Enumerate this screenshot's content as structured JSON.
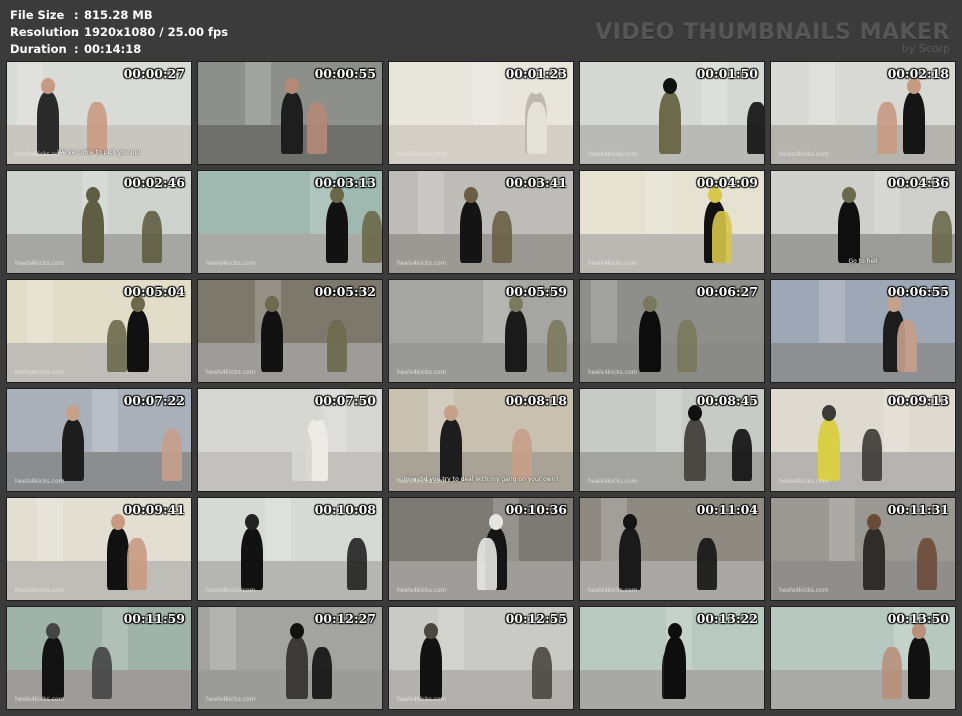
{
  "info": {
    "rows": [
      {
        "label": "File Size",
        "value": "815.28 MB"
      },
      {
        "label": "Resolution",
        "value": "1920x1080 / 25.00 fps"
      },
      {
        "label": "Duration",
        "value": "00:14:18"
      }
    ],
    "separator": ":"
  },
  "brand": {
    "title": "VIDEO THUMBNAILS MAKER",
    "subtitle": "by Scorp"
  },
  "thumbnails": [
    {
      "time": "00:00:27",
      "watermark": "heels4kicks.com",
      "subtitle": "We've come to pick you up!",
      "wall": "#d9dbd6",
      "floor": "#c9c6bf",
      "accent": "#2a2a2a",
      "skin": "#c99a82"
    },
    {
      "time": "00:00:55",
      "watermark": "",
      "subtitle": "",
      "wall": "#8d8f8a",
      "floor": "#6f706c",
      "accent": "#1e1e1e",
      "skin": "#b48a74"
    },
    {
      "time": "00:01:23",
      "watermark": "heels4kicks.com",
      "subtitle": "",
      "wall": "#e8e5dc",
      "floor": "#d3cfc6",
      "accent": "#bfb9ad",
      "skin": "#e8e5dc"
    },
    {
      "time": "00:01:50",
      "watermark": "heels4kicks.com",
      "subtitle": "",
      "wall": "#d5d8d2",
      "floor": "#b9bab5",
      "accent": "#6c6a4a",
      "skin": "#111111"
    },
    {
      "time": "00:02:18",
      "watermark": "heels4kicks.com",
      "subtitle": "",
      "wall": "#d8d8d4",
      "floor": "#b4b3ae",
      "accent": "#151515",
      "skin": "#c99a82"
    },
    {
      "time": "00:02:46",
      "watermark": "heels4kicks.com",
      "subtitle": "",
      "wall": "#cfd3cd",
      "floor": "#a6a7a2",
      "accent": "#5f5e42",
      "skin": "#5f5e42"
    },
    {
      "time": "00:03:13",
      "watermark": "heels4kicks.com",
      "subtitle": "",
      "wall": "#9fb8b0",
      "floor": "#a9aaa5",
      "accent": "#121212",
      "skin": "#6a6849"
    },
    {
      "time": "00:03:41",
      "watermark": "heels4kicks.com",
      "subtitle": "",
      "wall": "#bdbcb8",
      "floor": "#9a9994",
      "accent": "#141414",
      "skin": "#6a5f45"
    },
    {
      "time": "00:04:09",
      "watermark": "heels4kicks.com",
      "subtitle": "",
      "wall": "#e5e2d2",
      "floor": "#b9b8b3",
      "accent": "#111111",
      "skin": "#d6c64a"
    },
    {
      "time": "00:04:36",
      "watermark": "",
      "subtitle": "Go to hell",
      "wall": "#cfd0cc",
      "floor": "#9c9d99",
      "accent": "#0f0f0f",
      "skin": "#6b6a4d"
    },
    {
      "time": "00:05:04",
      "watermark": "heels4kicks.com",
      "subtitle": "",
      "wall": "#e1ddc9",
      "floor": "#bebdb7",
      "accent": "#111111",
      "skin": "#6b6a4d"
    },
    {
      "time": "00:05:32",
      "watermark": "heels4kicks.com",
      "subtitle": "",
      "wall": "#7d786c",
      "floor": "#9d9c98",
      "accent": "#121212",
      "skin": "#6b6a4d"
    },
    {
      "time": "00:05:59",
      "watermark": "heels4kicks.com",
      "subtitle": "",
      "wall": "#a5a5a2",
      "floor": "#999995",
      "accent": "#1a1a1a",
      "skin": "#7c7a5d"
    },
    {
      "time": "00:06:27",
      "watermark": "heels4kicks.com",
      "subtitle": "",
      "wall": "#8e8e8b",
      "floor": "#8a8a87",
      "accent": "#0d0d0d",
      "skin": "#7a785a"
    },
    {
      "time": "00:06:55",
      "watermark": "",
      "subtitle": "",
      "wall": "#9ea7b5",
      "floor": "#8d8f92",
      "accent": "#1c1c1c",
      "skin": "#c7a08a"
    },
    {
      "time": "00:07:22",
      "watermark": "heels4kicks.com",
      "subtitle": "",
      "wall": "#a9b0b9",
      "floor": "#8c8d8f",
      "accent": "#1d1d1d",
      "skin": "#c7a08a"
    },
    {
      "time": "00:07:50",
      "watermark": "",
      "subtitle": "",
      "wall": "#d6d6d3",
      "floor": "#c2c1bd",
      "accent": "#ecebe6",
      "skin": "#d6d6d3"
    },
    {
      "time": "00:08:18",
      "watermark": "heels4kicks.com",
      "subtitle": "How did you try to deal with my gang on your own?",
      "wall": "#c9c1b0",
      "floor": "#a9a397",
      "accent": "#1d1d1d",
      "skin": "#c7a08a"
    },
    {
      "time": "00:08:45",
      "watermark": "heels4kicks.com",
      "subtitle": "",
      "wall": "#c7cac6",
      "floor": "#a3a4a0",
      "accent": "#4a4842",
      "skin": "#101010"
    },
    {
      "time": "00:09:13",
      "watermark": "heels4kicks.com",
      "subtitle": "",
      "wall": "#dedad0",
      "floor": "#b5b4b0",
      "accent": "#d8cf45",
      "skin": "#3b3a37"
    },
    {
      "time": "00:09:41",
      "watermark": "heels4kicks.com",
      "subtitle": "",
      "wall": "#e2dfd2",
      "floor": "#bebdb8",
      "accent": "#111111",
      "skin": "#c99a82"
    },
    {
      "time": "00:10:08",
      "watermark": "heels4kicks.com",
      "subtitle": "",
      "wall": "#d6dad4",
      "floor": "#b5b5b1",
      "accent": "#121212",
      "skin": "#222222"
    },
    {
      "time": "00:10:36",
      "watermark": "heels4kicks.com",
      "subtitle": "",
      "wall": "#7c7a73",
      "floor": "#9e9d99",
      "accent": "#151515",
      "skin": "#e5e5e2"
    },
    {
      "time": "00:11:04",
      "watermark": "heels4kicks.com",
      "subtitle": "",
      "wall": "#8e8a82",
      "floor": "#a9a8a4",
      "accent": "#1a1a1a",
      "skin": "#141414"
    },
    {
      "time": "00:11:31",
      "watermark": "heels4kicks.com",
      "subtitle": "",
      "wall": "#9a9893",
      "floor": "#8f8e8a",
      "accent": "#2f2d2a",
      "skin": "#6b4a38"
    },
    {
      "time": "00:11:59",
      "watermark": "heels4kicks.com",
      "subtitle": "",
      "wall": "#9fb3a9",
      "floor": "#9d9c98",
      "accent": "#131313",
      "skin": "#454545"
    },
    {
      "time": "00:12:27",
      "watermark": "heels4kicks.com",
      "subtitle": "",
      "wall": "#a3a3a0",
      "floor": "#9b9b97",
      "accent": "#3c3a36",
      "skin": "#121212"
    },
    {
      "time": "00:12:55",
      "watermark": "heels4kicks.com",
      "subtitle": "",
      "wall": "#c9c9c5",
      "floor": "#b2b1ad",
      "accent": "#121212",
      "skin": "#4a4741"
    },
    {
      "time": "00:13:22",
      "watermark": "",
      "subtitle": "",
      "wall": "#b8c9bf",
      "floor": "#a8a8a4",
      "accent": "#0e0e0e",
      "skin": "#0e0e0e"
    },
    {
      "time": "00:13:50",
      "watermark": "",
      "subtitle": "",
      "wall": "#b6c8c0",
      "floor": "#a9aaa6",
      "accent": "#111111",
      "skin": "#b8907a"
    }
  ]
}
